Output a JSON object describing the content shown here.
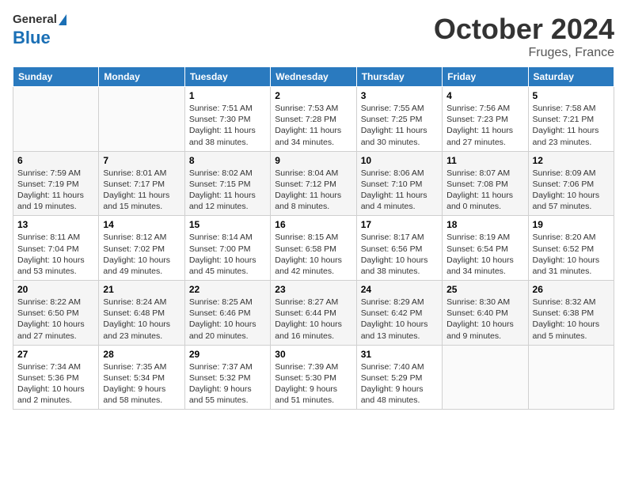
{
  "header": {
    "logo_line1": "General",
    "logo_line2": "Blue",
    "month": "October 2024",
    "location": "Fruges, France"
  },
  "days_of_week": [
    "Sunday",
    "Monday",
    "Tuesday",
    "Wednesday",
    "Thursday",
    "Friday",
    "Saturday"
  ],
  "weeks": [
    [
      {
        "day": "",
        "sunrise": "",
        "sunset": "",
        "daylight": ""
      },
      {
        "day": "",
        "sunrise": "",
        "sunset": "",
        "daylight": ""
      },
      {
        "day": "1",
        "sunrise": "Sunrise: 7:51 AM",
        "sunset": "Sunset: 7:30 PM",
        "daylight": "Daylight: 11 hours and 38 minutes."
      },
      {
        "day": "2",
        "sunrise": "Sunrise: 7:53 AM",
        "sunset": "Sunset: 7:28 PM",
        "daylight": "Daylight: 11 hours and 34 minutes."
      },
      {
        "day": "3",
        "sunrise": "Sunrise: 7:55 AM",
        "sunset": "Sunset: 7:25 PM",
        "daylight": "Daylight: 11 hours and 30 minutes."
      },
      {
        "day": "4",
        "sunrise": "Sunrise: 7:56 AM",
        "sunset": "Sunset: 7:23 PM",
        "daylight": "Daylight: 11 hours and 27 minutes."
      },
      {
        "day": "5",
        "sunrise": "Sunrise: 7:58 AM",
        "sunset": "Sunset: 7:21 PM",
        "daylight": "Daylight: 11 hours and 23 minutes."
      }
    ],
    [
      {
        "day": "6",
        "sunrise": "Sunrise: 7:59 AM",
        "sunset": "Sunset: 7:19 PM",
        "daylight": "Daylight: 11 hours and 19 minutes."
      },
      {
        "day": "7",
        "sunrise": "Sunrise: 8:01 AM",
        "sunset": "Sunset: 7:17 PM",
        "daylight": "Daylight: 11 hours and 15 minutes."
      },
      {
        "day": "8",
        "sunrise": "Sunrise: 8:02 AM",
        "sunset": "Sunset: 7:15 PM",
        "daylight": "Daylight: 11 hours and 12 minutes."
      },
      {
        "day": "9",
        "sunrise": "Sunrise: 8:04 AM",
        "sunset": "Sunset: 7:12 PM",
        "daylight": "Daylight: 11 hours and 8 minutes."
      },
      {
        "day": "10",
        "sunrise": "Sunrise: 8:06 AM",
        "sunset": "Sunset: 7:10 PM",
        "daylight": "Daylight: 11 hours and 4 minutes."
      },
      {
        "day": "11",
        "sunrise": "Sunrise: 8:07 AM",
        "sunset": "Sunset: 7:08 PM",
        "daylight": "Daylight: 11 hours and 0 minutes."
      },
      {
        "day": "12",
        "sunrise": "Sunrise: 8:09 AM",
        "sunset": "Sunset: 7:06 PM",
        "daylight": "Daylight: 10 hours and 57 minutes."
      }
    ],
    [
      {
        "day": "13",
        "sunrise": "Sunrise: 8:11 AM",
        "sunset": "Sunset: 7:04 PM",
        "daylight": "Daylight: 10 hours and 53 minutes."
      },
      {
        "day": "14",
        "sunrise": "Sunrise: 8:12 AM",
        "sunset": "Sunset: 7:02 PM",
        "daylight": "Daylight: 10 hours and 49 minutes."
      },
      {
        "day": "15",
        "sunrise": "Sunrise: 8:14 AM",
        "sunset": "Sunset: 7:00 PM",
        "daylight": "Daylight: 10 hours and 45 minutes."
      },
      {
        "day": "16",
        "sunrise": "Sunrise: 8:15 AM",
        "sunset": "Sunset: 6:58 PM",
        "daylight": "Daylight: 10 hours and 42 minutes."
      },
      {
        "day": "17",
        "sunrise": "Sunrise: 8:17 AM",
        "sunset": "Sunset: 6:56 PM",
        "daylight": "Daylight: 10 hours and 38 minutes."
      },
      {
        "day": "18",
        "sunrise": "Sunrise: 8:19 AM",
        "sunset": "Sunset: 6:54 PM",
        "daylight": "Daylight: 10 hours and 34 minutes."
      },
      {
        "day": "19",
        "sunrise": "Sunrise: 8:20 AM",
        "sunset": "Sunset: 6:52 PM",
        "daylight": "Daylight: 10 hours and 31 minutes."
      }
    ],
    [
      {
        "day": "20",
        "sunrise": "Sunrise: 8:22 AM",
        "sunset": "Sunset: 6:50 PM",
        "daylight": "Daylight: 10 hours and 27 minutes."
      },
      {
        "day": "21",
        "sunrise": "Sunrise: 8:24 AM",
        "sunset": "Sunset: 6:48 PM",
        "daylight": "Daylight: 10 hours and 23 minutes."
      },
      {
        "day": "22",
        "sunrise": "Sunrise: 8:25 AM",
        "sunset": "Sunset: 6:46 PM",
        "daylight": "Daylight: 10 hours and 20 minutes."
      },
      {
        "day": "23",
        "sunrise": "Sunrise: 8:27 AM",
        "sunset": "Sunset: 6:44 PM",
        "daylight": "Daylight: 10 hours and 16 minutes."
      },
      {
        "day": "24",
        "sunrise": "Sunrise: 8:29 AM",
        "sunset": "Sunset: 6:42 PM",
        "daylight": "Daylight: 10 hours and 13 minutes."
      },
      {
        "day": "25",
        "sunrise": "Sunrise: 8:30 AM",
        "sunset": "Sunset: 6:40 PM",
        "daylight": "Daylight: 10 hours and 9 minutes."
      },
      {
        "day": "26",
        "sunrise": "Sunrise: 8:32 AM",
        "sunset": "Sunset: 6:38 PM",
        "daylight": "Daylight: 10 hours and 5 minutes."
      }
    ],
    [
      {
        "day": "27",
        "sunrise": "Sunrise: 7:34 AM",
        "sunset": "Sunset: 5:36 PM",
        "daylight": "Daylight: 10 hours and 2 minutes."
      },
      {
        "day": "28",
        "sunrise": "Sunrise: 7:35 AM",
        "sunset": "Sunset: 5:34 PM",
        "daylight": "Daylight: 9 hours and 58 minutes."
      },
      {
        "day": "29",
        "sunrise": "Sunrise: 7:37 AM",
        "sunset": "Sunset: 5:32 PM",
        "daylight": "Daylight: 9 hours and 55 minutes."
      },
      {
        "day": "30",
        "sunrise": "Sunrise: 7:39 AM",
        "sunset": "Sunset: 5:30 PM",
        "daylight": "Daylight: 9 hours and 51 minutes."
      },
      {
        "day": "31",
        "sunrise": "Sunrise: 7:40 AM",
        "sunset": "Sunset: 5:29 PM",
        "daylight": "Daylight: 9 hours and 48 minutes."
      },
      {
        "day": "",
        "sunrise": "",
        "sunset": "",
        "daylight": ""
      },
      {
        "day": "",
        "sunrise": "",
        "sunset": "",
        "daylight": ""
      }
    ]
  ]
}
